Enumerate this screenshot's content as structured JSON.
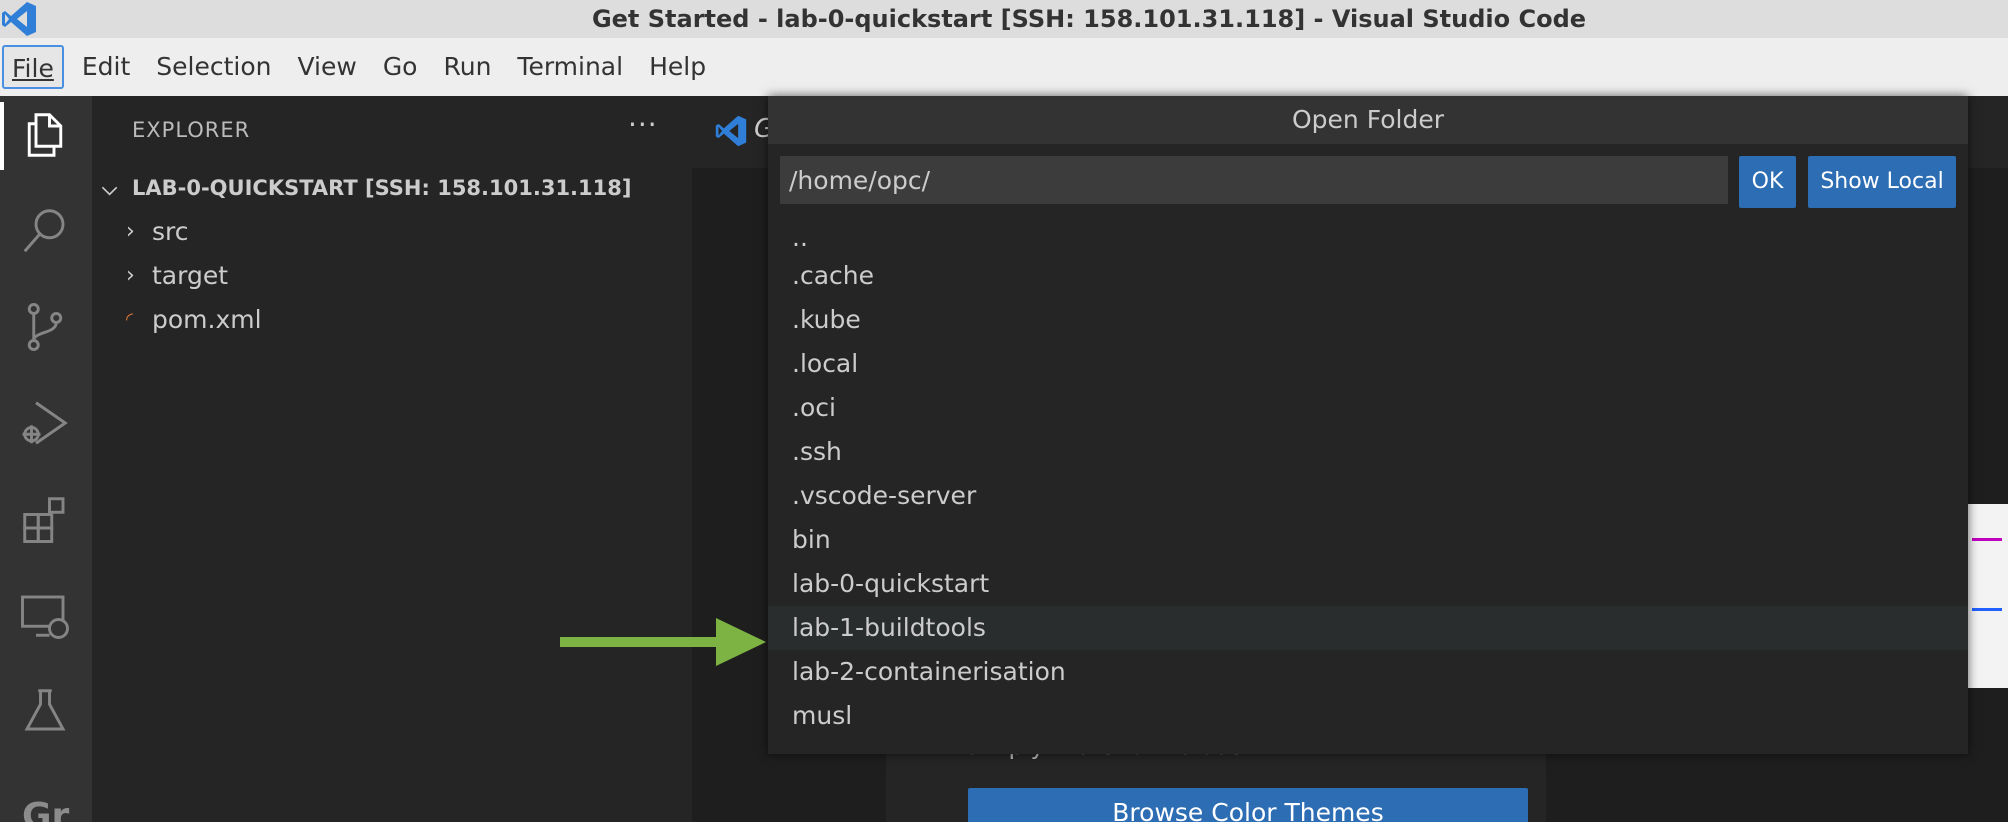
{
  "window": {
    "title": "Get Started - lab-0-quickstart [SSH: 158.101.31.118] - Visual Studio Code"
  },
  "menubar": {
    "items": [
      "File",
      "Edit",
      "Selection",
      "View",
      "Go",
      "Run",
      "Terminal",
      "Help"
    ],
    "active": "File"
  },
  "activitybar": {
    "icons": [
      "explorer-icon",
      "search-icon",
      "source-control-icon",
      "run-debug-icon",
      "extensions-icon",
      "remote-explorer-icon",
      "testing-icon"
    ],
    "extra_label": "Gr"
  },
  "sidebar": {
    "title": "EXPLORER",
    "more": "···",
    "root": "LAB-0-QUICKSTART [SSH: 158.101.31.118]",
    "items": [
      {
        "label": "src",
        "type": "folder"
      },
      {
        "label": "target",
        "type": "folder"
      },
      {
        "label": "pom.xml",
        "type": "file"
      }
    ]
  },
  "editor": {
    "tab_letter": "G",
    "welcome_text": "simply more fun to use.",
    "browse_button": "Browse Color Themes"
  },
  "quickpick": {
    "title": "Open Folder",
    "input_value": "/home/opc/",
    "ok_label": "OK",
    "show_local_label": "Show Local",
    "items": [
      "..",
      ".cache",
      ".kube",
      ".local",
      ".oci",
      ".ssh",
      ".vscode-server",
      "bin",
      "lab-0-quickstart",
      "lab-1-buildtools",
      "lab-2-containerisation",
      "musl"
    ],
    "highlighted": "lab-1-buildtools"
  },
  "colors": {
    "accent_button": "#2c6db3",
    "arrow": "#7cb342",
    "vscode_blue": "#2f7fd8",
    "rss_orange": "#e37933"
  }
}
